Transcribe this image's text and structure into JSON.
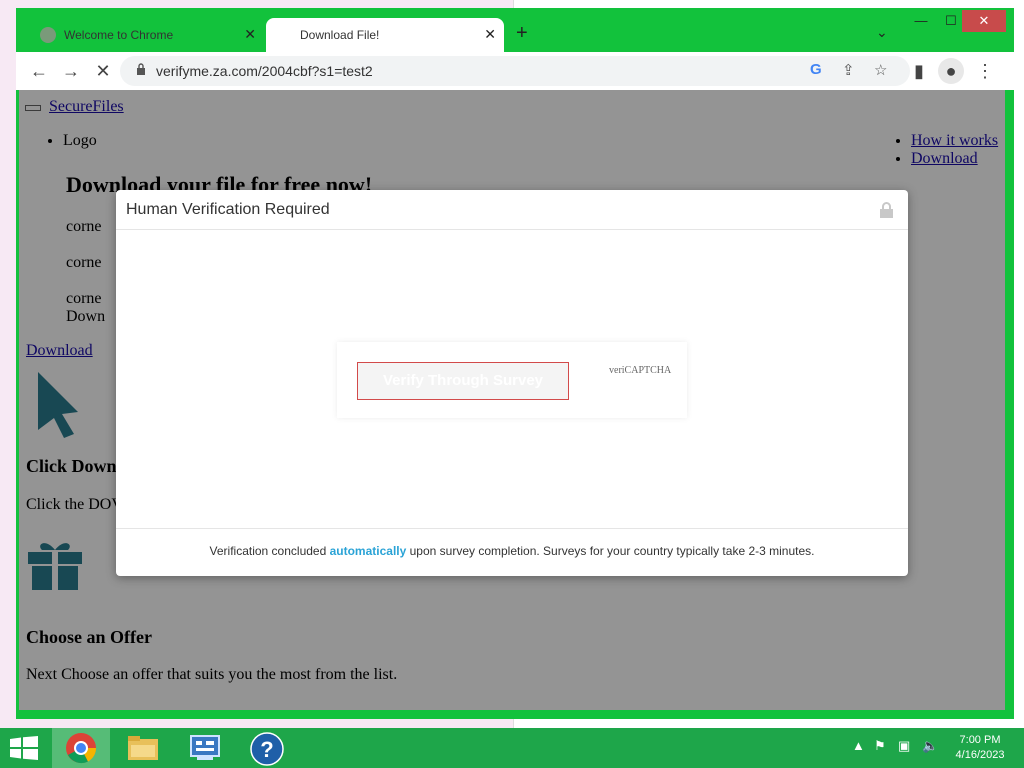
{
  "browser": {
    "tabs": [
      {
        "label": "Welcome to Chrome"
      },
      {
        "label": "Download File!"
      }
    ],
    "url": "verifyme.za.com/2004cbf?s1=test2"
  },
  "page": {
    "brand_link": "SecureFiles",
    "logo_alt": "Logo",
    "nav": [
      "How it works",
      "Download"
    ],
    "headline": "Download your file for free now!",
    "corner_images": [
      "corne",
      "corne",
      "corne"
    ],
    "download_img": "Down",
    "download_link": "Download",
    "step1_title": "Click Down",
    "step1_text": "Click the DOV",
    "step2_title": "Choose an Offer",
    "step2_text": "Next Choose an offer that suits you the most from the list."
  },
  "modal": {
    "title": "Human Verification Required",
    "button": "Verify Through Survey",
    "captcha_label": "veriCAPTCHA",
    "footer_before": "Verification concluded ",
    "footer_highlight": "automatically",
    "footer_after": " upon survey completion. Surveys for your country typically take 2-3 minutes."
  },
  "taskbar": {
    "time": "7:00 PM",
    "date": "4/16/2023"
  },
  "colors": {
    "window_frame": "#12c23c",
    "taskbar": "#1ea64a",
    "highlight": "#2aa3d6",
    "button_border": "#d24a4a"
  }
}
